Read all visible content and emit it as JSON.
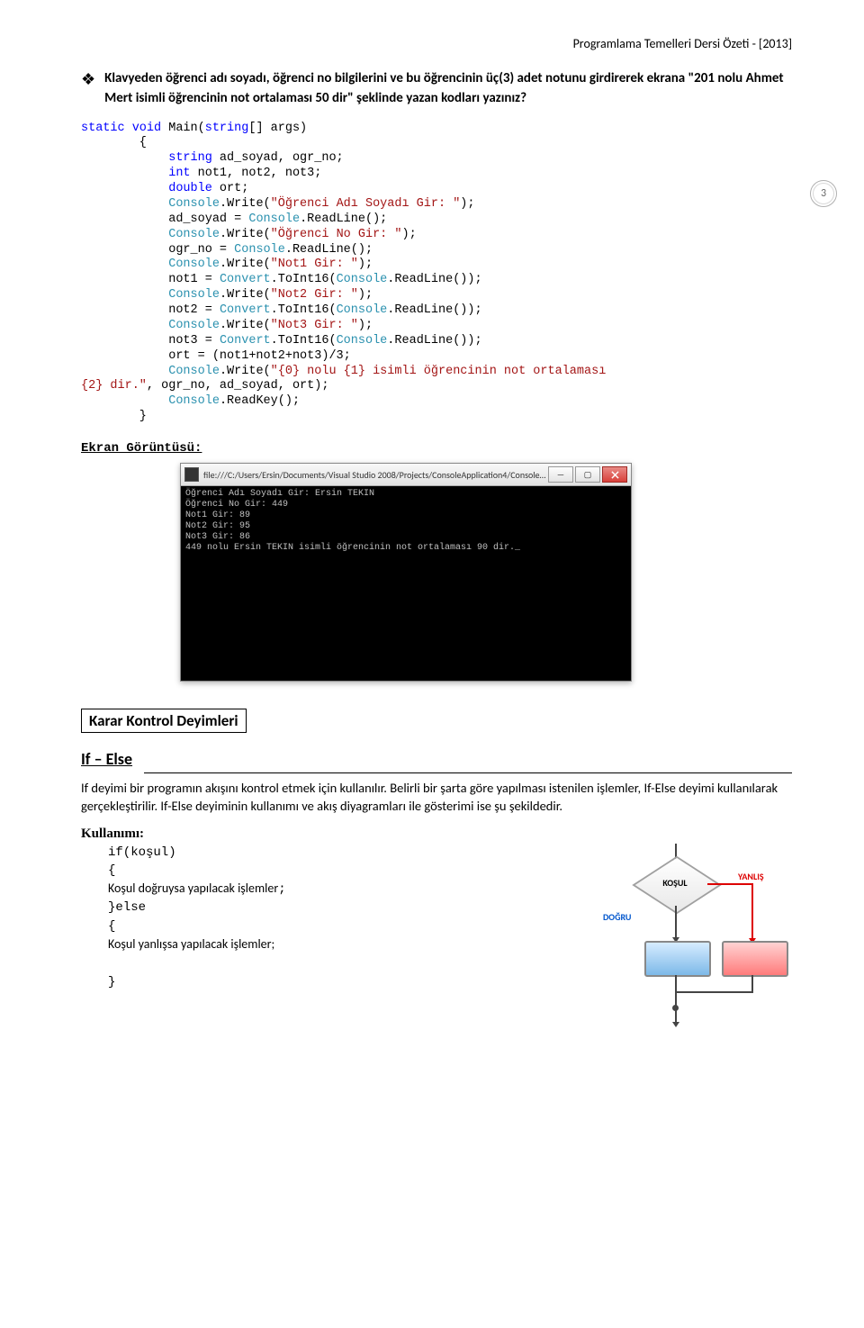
{
  "header": "Programlama Temelleri Dersi Özeti  - [2013]",
  "page_number": "3",
  "problem_statement": "Klavyeden öğrenci adı soyadı, öğrenci no bilgilerini ve bu öğrencinin üç(3) adet notunu girdirerek ekrana \"201 nolu Ahmet Mert isimli öğrencinin not ortalaması 50 dir\" şeklinde yazan kodları yazınız?",
  "code": {
    "l1a": "static",
    "l1b": " void",
    "l1c": " Main(",
    "l1d": "string",
    "l1e": "[] args)",
    "l2": "        {",
    "l3a": "            string",
    "l3b": " ad_soyad, ogr_no;",
    "l4a": "            int",
    "l4b": " not1, not2, not3;",
    "l5a": "            double",
    "l5b": " ort;",
    "l6a": "            Console",
    "l6b": ".Write(",
    "l6c": "\"Öğrenci Adı Soyadı Gir: \"",
    "l6d": ");",
    "l7a": "            ad_soyad = ",
    "l7b": "Console",
    "l7c": ".ReadLine();",
    "l8a": "            Console",
    "l8b": ".Write(",
    "l8c": "\"Öğrenci No Gir: \"",
    "l8d": ");",
    "l9a": "            ogr_no = ",
    "l9b": "Console",
    "l9c": ".ReadLine();",
    "l10a": "            Console",
    "l10b": ".Write(",
    "l10c": "\"Not1 Gir: \"",
    "l10d": ");",
    "l11a": "            not1 = ",
    "l11b": "Convert",
    "l11c": ".ToInt16(",
    "l11d": "Console",
    "l11e": ".ReadLine());",
    "l12a": "            Console",
    "l12b": ".Write(",
    "l12c": "\"Not2 Gir: \"",
    "l12d": ");",
    "l13a": "            not2 = ",
    "l13b": "Convert",
    "l13c": ".ToInt16(",
    "l13d": "Console",
    "l13e": ".ReadLine());",
    "l14a": "            Console",
    "l14b": ".Write(",
    "l14c": "\"Not3 Gir: \"",
    "l14d": ");",
    "l15a": "            not3 = ",
    "l15b": "Convert",
    "l15c": ".ToInt16(",
    "l15d": "Console",
    "l15e": ".ReadLine());",
    "l16": "            ort = (not1+not2+not3)/3;",
    "l17a": "            Console",
    "l17b": ".Write(",
    "l17c": "\"{0} nolu {1} isimli öğrencinin not ortalaması ",
    "l17d": "",
    "l18a": "{2} dir.\"",
    "l18b": ", ogr_no, ad_soyad, ort);",
    "l19a": "            Console",
    "l19b": ".ReadKey();",
    "l20": "        }"
  },
  "screenshot_label": "Ekran Görüntüsü:",
  "console": {
    "title": "file:///C:/Users/Ersin/Documents/Visual Studio 2008/Projects/ConsoleApplication4/ConsoleApplica...",
    "lines": "Öğrenci Adı Soyadı Gir: Ersin TEKIN\nÖğrenci No Gir: 449\nNot1 Gir: 89\nNot2 Gir: 95\nNot3 Gir: 86\n449 nolu Ersin TEKIN isimli öğrencinin not ortalaması 90 dir._"
  },
  "section_heading": "Karar Kontrol Deyimleri",
  "if_else": {
    "title": "If – Else",
    "desc": "If deyimi bir programın akışını kontrol etmek için kullanılır. Belirli bir şarta göre yapılması istenilen işlemler, If-Else deyimi kullanılarak gerçekleştirilir. If-Else deyiminin kullanımı ve akış diyagramları ile gösterimi ise şu şekildedir.",
    "usage_label": "Kullanımı:",
    "u1": "if(koşul)",
    "u2": "{",
    "u3": "Koşul doğruysa yapılacak işlemler",
    "u3b": ";",
    "u4": "}else",
    "u5": "{",
    "u6": "Koşul yanlışsa yapılacak işlemler;",
    "u7": "",
    "u8": "}"
  },
  "flowchart": {
    "condition": "KOŞUL",
    "true": "DOĞRU",
    "false": "YANLIŞ"
  }
}
